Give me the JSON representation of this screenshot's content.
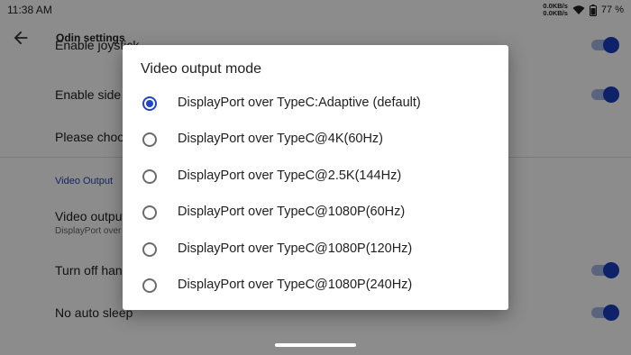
{
  "status_bar": {
    "time": "11:38 AM",
    "net_up": "0.0KB/s",
    "net_down": "0.0KB/s",
    "battery": "77 %"
  },
  "app_bar": {
    "title": "Odin settings",
    "back_icon": "arrow-back-icon"
  },
  "settings": {
    "row_joystick": {
      "title": "Enable joystick",
      "toggle_on": true
    },
    "row_side": {
      "title": "Enable side buttons",
      "toggle_on": true
    },
    "row_choose": {
      "title": "Please choose"
    },
    "category": "Video Output",
    "row_video": {
      "title": "Video output mode",
      "summary": "DisplayPort over TypeC:Adaptive (default)"
    },
    "row_handle": {
      "title": "Turn off handle",
      "toggle_on": true
    },
    "row_sleep": {
      "title": "No auto sleep",
      "toggle_on": true
    }
  },
  "dialog": {
    "title": "Video output mode",
    "selected_index": 0,
    "options": [
      "DisplayPort over TypeC:Adaptive (default)",
      "DisplayPort over TypeC@4K(60Hz)",
      "DisplayPort over TypeC@2.5K(144Hz)",
      "DisplayPort over TypeC@1080P(60Hz)",
      "DisplayPort over TypeC@1080P(120Hz)",
      "DisplayPort over TypeC@1080P(240Hz)"
    ]
  },
  "colors": {
    "accent": "#2346c2",
    "scrim": "#000000"
  }
}
